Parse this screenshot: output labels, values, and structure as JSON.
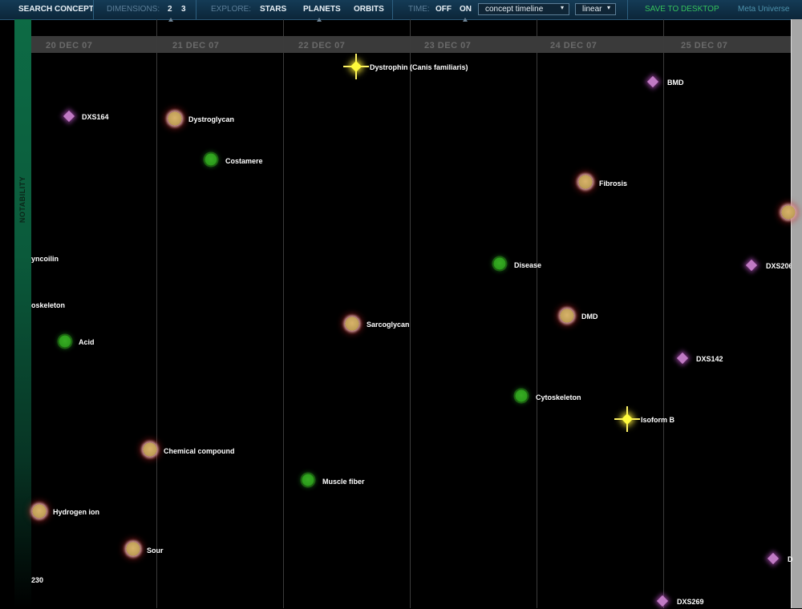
{
  "toolbar": {
    "search": "SEARCH CONCEPT",
    "dimensions_label": "DIMENSIONS:",
    "dim2": "2",
    "dim3": "3",
    "explore_label": "EXPLORE:",
    "stars": "STARS",
    "planets": "PLANETS",
    "orbits": "ORBITS",
    "time_label": "TIME:",
    "off": "OFF",
    "on": "ON",
    "timeline_select": "concept timeline",
    "scale_select": "linear",
    "save": "SAVE TO DESKTOP",
    "meta": "Meta Universe"
  },
  "notability": {
    "label": "NOTABILITY"
  },
  "timeline": {
    "dates": [
      "20 DEC 07",
      "21 DEC 07",
      "22 DEC 07",
      "23 DEC 07",
      "24 DEC 07",
      "25 DEC 07"
    ]
  },
  "nodes": {
    "dystrophin": "Dystrophin (Canis familiaris)",
    "bmd": "BMD",
    "dxs164": "DXS164",
    "dystroglycan": "Dystroglycan",
    "costamere": "Costamere",
    "fibrosis": "Fibrosis",
    "syncoilin": "yncoilin",
    "disease": "Disease",
    "dxs206": "DXS206",
    "cytoskeleton_left": "oskeleton",
    "sarcoglycan": "Sarcoglycan",
    "dmd": "DMD",
    "acid": "Acid",
    "dxs142": "DXS142",
    "cytoskeleton": "Cytoskeleton",
    "isoform_b": "Isoform B",
    "chemical_compound": "Chemical compound",
    "muscle_fiber": "Muscle fiber",
    "hydrogen_ion": "Hydrogen ion",
    "sour": "Sour",
    "d_right": "D",
    "n230": "230",
    "dxs269": "DXS269"
  },
  "colors": {
    "toolbar_bg": "#143b56",
    "planet": "#c3a25a",
    "orbit": "#2b9a1b",
    "star_purple": "#c07ac4",
    "star_yellow": "#fffb3b",
    "notability": "#0d6b45"
  }
}
